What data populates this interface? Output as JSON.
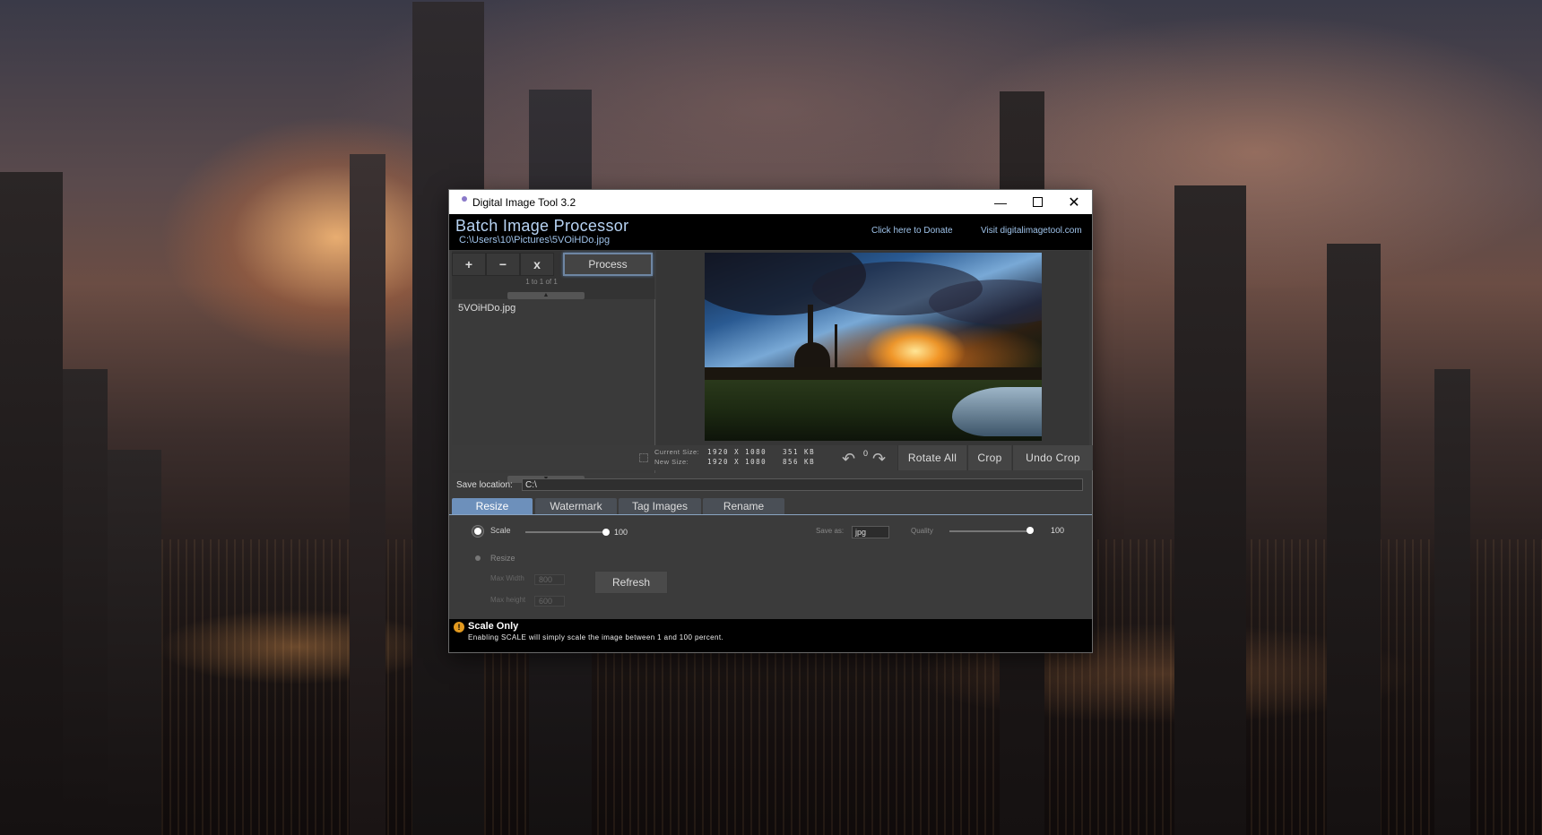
{
  "window": {
    "title": "Digital Image Tool 3.2",
    "controls": {
      "minimize": "—",
      "close": "✕"
    }
  },
  "header": {
    "title": "Batch Image Processor",
    "path": "C:\\Users\\10\\Pictures\\5VOiHDo.jpg",
    "donate_link": "Click here to Donate",
    "site_link": "Visit digitalimagetool.com"
  },
  "file_list": {
    "buttons": {
      "add": "+",
      "remove": "−",
      "clear": "x",
      "process": "Process"
    },
    "paging": "1 to 1 of 1",
    "items": [
      "5VOiHDo.jpg"
    ],
    "scroll_up": "▲",
    "scroll_down": "▼"
  },
  "image_info": {
    "current_size_label": "Current Size:",
    "current_dims": "1920 X 1080",
    "current_kb": "351 KB",
    "new_size_label": "New Size:",
    "new_dims": "1920 X 1080",
    "new_kb": "856 KB",
    "rotation": "0",
    "rotate_all": "Rotate All",
    "crop": "Crop",
    "undo_crop": "Undo Crop"
  },
  "save": {
    "label": "Save location:",
    "value": "C:\\"
  },
  "tabs": [
    "Resize",
    "Watermark",
    "Tag Images",
    "Rename"
  ],
  "resize_panel": {
    "scale_label": "Scale",
    "scale_value": "100",
    "scale_selected": true,
    "resize_label": "Resize",
    "max_width_label": "Max Width",
    "max_width": "800",
    "max_height_label": "Max height",
    "max_height": "600",
    "refresh": "Refresh",
    "save_as_label": "Save as:",
    "save_as": "jpg",
    "quality_label": "Quality",
    "quality_value": "100"
  },
  "status": {
    "icon": "!",
    "title": "Scale Only",
    "message": "Enabling SCALE will simply scale the image between 1 and 100 percent."
  },
  "colors": {
    "accent": "#6d90bb",
    "header_text": "#b7d3f3",
    "warning": "#e39a1f"
  }
}
